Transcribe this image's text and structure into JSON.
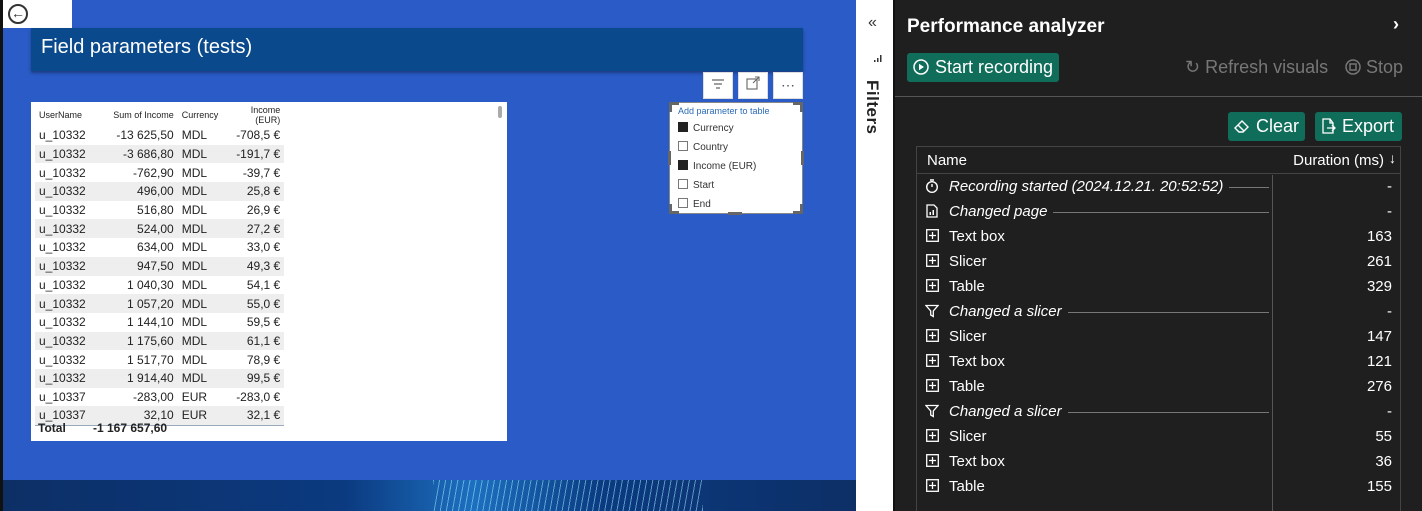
{
  "canvas": {
    "title": "Field parameters (tests)",
    "back_icon": "back-arrow-icon",
    "header_icons": [
      "filter-icon",
      "focus-mode-icon",
      "more-options-icon"
    ]
  },
  "table": {
    "columns": [
      "UserName",
      "Sum of Income",
      "Currency",
      "Income (EUR)"
    ],
    "rows": [
      [
        "u_10332",
        "-13 625,50",
        "MDL",
        "-708,5 €"
      ],
      [
        "u_10332",
        "-3 686,80",
        "MDL",
        "-191,7 €"
      ],
      [
        "u_10332",
        "-762,90",
        "MDL",
        "-39,7 €"
      ],
      [
        "u_10332",
        "496,00",
        "MDL",
        "25,8 €"
      ],
      [
        "u_10332",
        "516,80",
        "MDL",
        "26,9 €"
      ],
      [
        "u_10332",
        "524,00",
        "MDL",
        "27,2 €"
      ],
      [
        "u_10332",
        "634,00",
        "MDL",
        "33,0 €"
      ],
      [
        "u_10332",
        "947,50",
        "MDL",
        "49,3 €"
      ],
      [
        "u_10332",
        "1 040,30",
        "MDL",
        "54,1 €"
      ],
      [
        "u_10332",
        "1 057,20",
        "MDL",
        "55,0 €"
      ],
      [
        "u_10332",
        "1 144,10",
        "MDL",
        "59,5 €"
      ],
      [
        "u_10332",
        "1 175,60",
        "MDL",
        "61,1 €"
      ],
      [
        "u_10332",
        "1 517,70",
        "MDL",
        "78,9 €"
      ],
      [
        "u_10332",
        "1 914,40",
        "MDL",
        "99,5 €"
      ],
      [
        "u_10337",
        "-283,00",
        "EUR",
        "-283,0 €"
      ],
      [
        "u_10337",
        "32,10",
        "EUR",
        "32,1 €"
      ]
    ],
    "total_label": "Total",
    "total_value": "-1 167 657,60"
  },
  "slicer": {
    "header": "Add parameter to table",
    "items": [
      {
        "label": "Currency",
        "checked": true
      },
      {
        "label": "Country",
        "checked": false
      },
      {
        "label": "Income (EUR)",
        "checked": true
      },
      {
        "label": "Start",
        "checked": false
      },
      {
        "label": "End",
        "checked": false
      }
    ]
  },
  "filters": {
    "label": "Filters",
    "collapse_icon": "double-chevron-left-icon"
  },
  "perf": {
    "title": "Performance analyzer",
    "expand_icon": "chevron-right-icon",
    "start_recording": "Start recording",
    "refresh_visuals": "Refresh visuals",
    "stop": "Stop",
    "clear": "Clear",
    "export": "Export",
    "col_name": "Name",
    "col_duration": "Duration (ms)",
    "rows": [
      {
        "icon": "stopwatch-icon",
        "name": "Recording started (2024.12.21. 20:52:52)",
        "duration": "-",
        "event": true
      },
      {
        "icon": "page-icon",
        "name": "Changed page",
        "duration": "-",
        "event": true
      },
      {
        "icon": "expand-plus-icon",
        "name": "Text box",
        "duration": "163",
        "event": false
      },
      {
        "icon": "expand-plus-icon",
        "name": "Slicer",
        "duration": "261",
        "event": false
      },
      {
        "icon": "expand-plus-icon",
        "name": "Table",
        "duration": "329",
        "event": false
      },
      {
        "icon": "funnel-icon",
        "name": "Changed a slicer",
        "duration": "-",
        "event": true
      },
      {
        "icon": "expand-plus-icon",
        "name": "Slicer",
        "duration": "147",
        "event": false
      },
      {
        "icon": "expand-plus-icon",
        "name": "Text box",
        "duration": "121",
        "event": false
      },
      {
        "icon": "expand-plus-icon",
        "name": "Table",
        "duration": "276",
        "event": false
      },
      {
        "icon": "funnel-icon",
        "name": "Changed a slicer",
        "duration": "-",
        "event": true
      },
      {
        "icon": "expand-plus-icon",
        "name": "Slicer",
        "duration": "55",
        "event": false
      },
      {
        "icon": "expand-plus-icon",
        "name": "Text box",
        "duration": "36",
        "event": false
      },
      {
        "icon": "expand-plus-icon",
        "name": "Table",
        "duration": "155",
        "event": false
      }
    ]
  }
}
